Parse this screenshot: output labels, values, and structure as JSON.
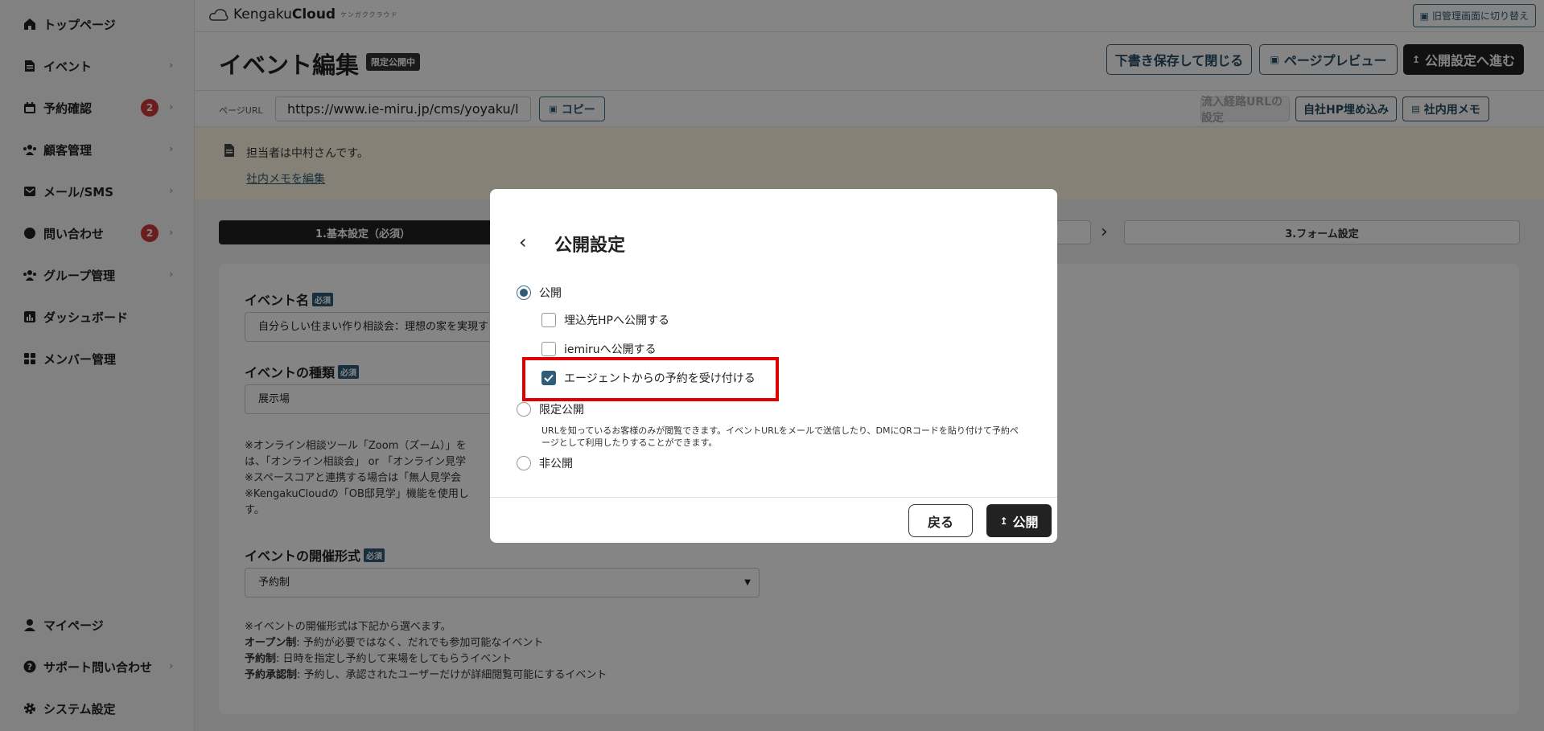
{
  "sidebar": {
    "items": [
      {
        "label": "トップページ",
        "icon": "home-icon"
      },
      {
        "label": "イベント",
        "icon": "document-icon"
      },
      {
        "label": "予約確認",
        "icon": "calendar-icon",
        "badge": "2"
      },
      {
        "label": "顧客管理",
        "icon": "people-icon"
      },
      {
        "label": "メール/SMS",
        "icon": "mail-icon"
      },
      {
        "label": "問い合わせ",
        "icon": "chat-icon",
        "badge": "2"
      },
      {
        "label": "グループ管理",
        "icon": "group-icon"
      },
      {
        "label": "ダッシュボード",
        "icon": "chart-icon"
      },
      {
        "label": "メンバー管理",
        "icon": "grid-icon"
      }
    ],
    "bottom_items": [
      {
        "label": "マイページ",
        "icon": "user-icon"
      },
      {
        "label": "サポート問い合わせ",
        "icon": "help-icon"
      },
      {
        "label": "システム設定",
        "icon": "gear-icon"
      }
    ]
  },
  "topbar": {
    "logo_main": "Kengaku",
    "logo_bold": "Cloud",
    "logo_sub": "ケンガククラウド",
    "legacy_button": "旧管理画面に切り替え"
  },
  "header": {
    "title": "イベント編集",
    "status": "限定公開中",
    "draft_button": "下書き保存して閉じる",
    "preview_button": "ページプレビュー",
    "publish_settings_button": "公開設定へ進む"
  },
  "url_bar": {
    "label": "ページURL",
    "url": "https://www.ie-miru.jp/cms/yoyaku/l",
    "copy_button": "コピー",
    "inflow_button": "流入経路URLの設定",
    "embed_button": "自社HP埋め込み",
    "memo_button": "社内用メモ"
  },
  "notice": {
    "text": "担当者は中村さんです。",
    "link": "社内メモを編集"
  },
  "steps": {
    "step1": "1.基本設定（必須）",
    "step3": "3.フォーム設定"
  },
  "form": {
    "required": "必須",
    "event_name_label": "イベント名",
    "event_name_value": "自分らしい住まい作り相談会：理想の家を実現す",
    "event_type_label": "イベントの種類",
    "event_type_value": "展示場",
    "type_note_1": "※オンライン相談ツール「Zoom（ズーム）」を",
    "type_note_2": "は、「オンライン相談会」 or 「オンライン見学",
    "type_note_3": "※スペースコアと連携する場合は「無人見学会",
    "type_note_4": "※KengakuCloudの「OB邸見学」機能を使用し",
    "type_note_5": "す。",
    "format_label": "イベントの開催形式",
    "format_value": "予約制",
    "format_note_intro": "※イベントの開催形式は下記から選べます。",
    "format_open_term": "オープン制",
    "format_open_desc": ": 予約が必要ではなく、だれでも参加可能なイベント",
    "format_reserve_term": "予約制",
    "format_reserve_desc": ": 日時を指定し予約して来場をしてもらうイベント",
    "format_approval_term": "予約承認制",
    "format_approval_desc": ": 予約し、承認されたユーザーだけが詳細閲覧可能にするイベント"
  },
  "modal": {
    "title": "公開設定",
    "public_label": "公開",
    "embed_label": "埋込先HPへ公開する",
    "iemiru_label": "iemiruへ公開する",
    "agent_label": "エージェントからの予約を受け付ける",
    "limited_label": "限定公開",
    "limited_desc": "URLを知っているお客様のみが閲覧できます。イベントURLをメールで送信したり、DMにQRコードを貼り付けて予約ページとして利用したりすることができます。",
    "private_label": "非公開",
    "back_button": "戻る",
    "publish_button": "公開",
    "selected": "public",
    "embed_checked": false,
    "iemiru_checked": false,
    "agent_checked": true
  }
}
